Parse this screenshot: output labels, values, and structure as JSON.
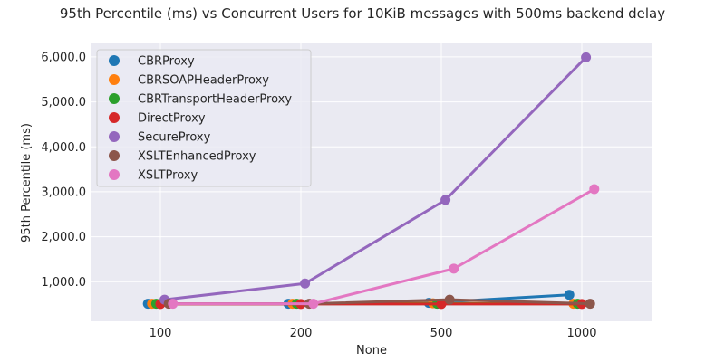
{
  "chart_data": {
    "type": "line",
    "title": "95th Percentile (ms) vs Concurrent Users for 10KiB messages with 500ms backend delay",
    "xlabel": "None",
    "ylabel": "95th Percentile (ms)",
    "categories": [
      "100",
      "200",
      "500",
      "1000"
    ],
    "ylim": [
      120,
      6300
    ],
    "yticks": [
      1000,
      2000,
      3000,
      4000,
      5000,
      6000
    ],
    "ytick_labels": [
      "1,000.0",
      "2,000.0",
      "3,000.0",
      "4,000.0",
      "5,000.0",
      "6,000.0"
    ],
    "grid": true,
    "legend_position": "top-left",
    "series": [
      {
        "name": "CBRProxy",
        "color": "#1f77b4",
        "values": [
          510,
          510,
          530,
          710
        ]
      },
      {
        "name": "CBRSOAPHeaderProxy",
        "color": "#ff7f0e",
        "values": [
          510,
          510,
          520,
          510
        ]
      },
      {
        "name": "CBRTransportHeaderProxy",
        "color": "#2ca02c",
        "values": [
          510,
          510,
          510,
          510
        ]
      },
      {
        "name": "DirectProxy",
        "color": "#d62728",
        "values": [
          505,
          505,
          505,
          505
        ]
      },
      {
        "name": "SecureProxy",
        "color": "#9467bd",
        "values": [
          600,
          960,
          2820,
          5990
        ]
      },
      {
        "name": "XSLTEnhancedProxy",
        "color": "#8c564b",
        "values": [
          510,
          510,
          600,
          510
        ]
      },
      {
        "name": "XSLTProxy",
        "color": "#e377c2",
        "values": [
          510,
          510,
          1290,
          3060
        ]
      }
    ]
  }
}
